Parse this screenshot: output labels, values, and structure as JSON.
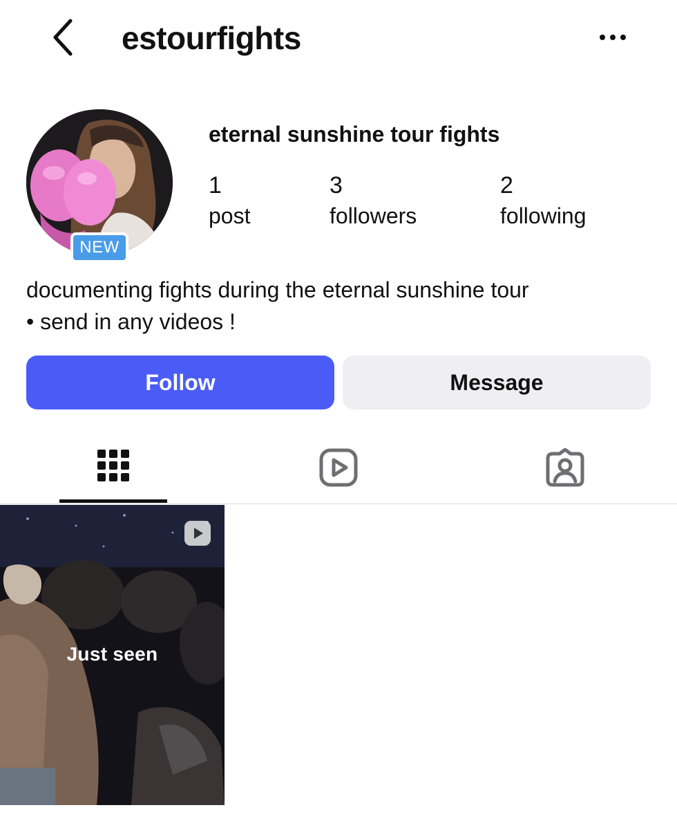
{
  "header": {
    "username": "estourfights",
    "back_icon": "chevron-left-icon",
    "more_icon": "more-horizontal-icon"
  },
  "profile": {
    "display_name": "eternal sunshine tour fights",
    "badge": "NEW",
    "stats": [
      {
        "value": "1",
        "label": "post"
      },
      {
        "value": "3",
        "label": "followers"
      },
      {
        "value": "2",
        "label": "following"
      }
    ],
    "bio_lines": [
      "documenting fights during the eternal sunshine tour",
      "• send in any videos !"
    ]
  },
  "actions": {
    "follow_label": "Follow",
    "message_label": "Message"
  },
  "tabs": [
    {
      "icon": "grid-icon",
      "active": true
    },
    {
      "icon": "reels-icon",
      "active": false
    },
    {
      "icon": "tagged-icon",
      "active": false
    }
  ],
  "posts": [
    {
      "overlay_text": "Just seen",
      "type_icon": "reel-icon"
    }
  ],
  "colors": {
    "follow_button": "#4a5cf5",
    "message_button": "#efeff3",
    "new_badge": "#4a9ce8",
    "text": "#111111"
  }
}
